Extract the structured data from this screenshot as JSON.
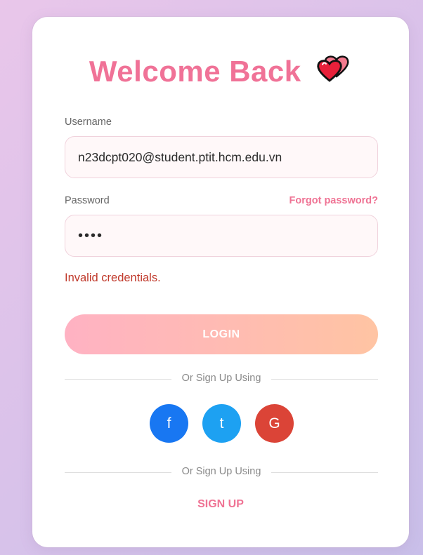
{
  "form": {
    "title": "Welcome Back",
    "username_label": "Username",
    "username_value": "n23dcpt020@student.ptit.hcm.edu.vn",
    "password_label": "Password",
    "forgot_label": "Forgot password?",
    "password_value": "••••",
    "error_message": "Invalid credentials.",
    "login_label": "LOGIN"
  },
  "social": {
    "divider_text": "Or Sign Up Using",
    "facebook_label": "f",
    "twitter_label": "t",
    "google_label": "G"
  },
  "signup": {
    "divider_text": "Or Sign Up Using",
    "signup_label": "SIGN UP"
  },
  "colors": {
    "accent": "#f07297",
    "error": "#c0392b",
    "facebook": "#1877f2",
    "twitter": "#1da1f2",
    "google": "#db4437"
  },
  "icons": {
    "title_icon": "two-hearts-icon"
  }
}
